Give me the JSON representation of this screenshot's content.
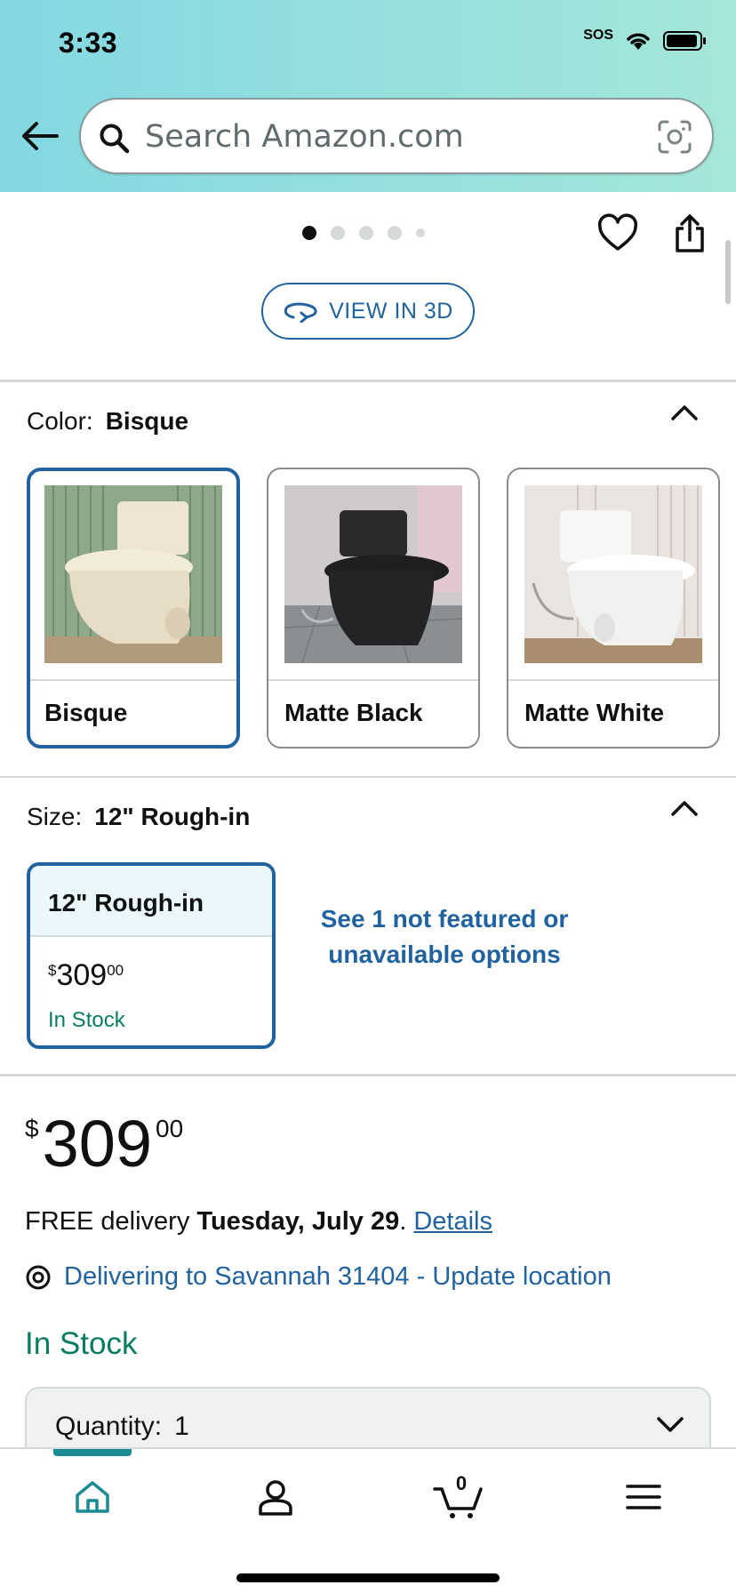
{
  "status_bar": {
    "time": "3:33",
    "sos": "SOS"
  },
  "search": {
    "placeholder": "Search Amazon.com"
  },
  "gallery": {
    "dot_count": 5,
    "active_dot": 0,
    "view_3d_label": "VIEW IN 3D"
  },
  "color": {
    "label": "Color:",
    "selected_value": "Bisque",
    "options": [
      {
        "label": "Bisque",
        "selected": true
      },
      {
        "label": "Matte Black",
        "selected": false
      },
      {
        "label": "Matte White",
        "selected": false
      }
    ]
  },
  "size": {
    "label": "Size:",
    "selected_value": "12\" Rough-in",
    "option": {
      "label": "12\" Rough-in",
      "currency": "$",
      "price_whole": "309",
      "price_fraction": "00",
      "stock": "In Stock"
    },
    "see_more": "See 1 not featured or unavailable options"
  },
  "buybox": {
    "currency": "$",
    "price_whole": "309",
    "price_fraction": "00",
    "delivery_prefix": "FREE delivery ",
    "delivery_date": "Tuesday, July 29",
    "delivery_suffix": ". ",
    "details_link": "Details",
    "location_text": "Delivering to Savannah 31404 - Update location",
    "stock_status": "In Stock",
    "quantity_label": "Quantity:",
    "quantity_value": "1"
  },
  "bottom_nav": {
    "items": [
      "home-icon",
      "account-icon",
      "cart-icon",
      "menu-icon"
    ],
    "cart_count": "0",
    "active": "home"
  },
  "colors": {
    "accent_blue": "#2162a1",
    "stock_green": "#067d62",
    "header_start": "#83d8e2",
    "header_end": "#a5e6d9",
    "nav_active": "#1a8a95"
  }
}
